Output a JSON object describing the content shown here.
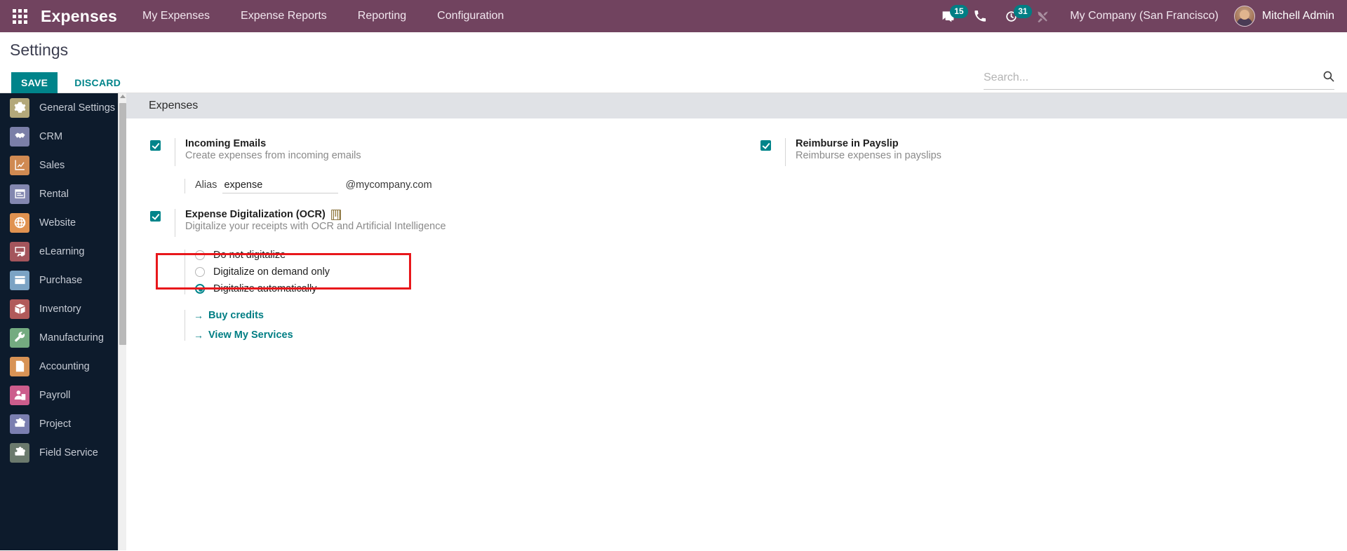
{
  "navbar": {
    "apps_icon": "apps-grid-icon",
    "brand": "Expenses",
    "menus": [
      {
        "label": "My Expenses"
      },
      {
        "label": "Expense Reports"
      },
      {
        "label": "Reporting"
      },
      {
        "label": "Configuration"
      }
    ],
    "messages_icon": "chat-bubble-icon",
    "messages_count": "15",
    "phone_icon": "phone-icon",
    "activities_icon": "clock-icon",
    "activities_count": "31",
    "debug_icon": "wrench-screwdriver-icon",
    "company": "My Company (San Francisco)",
    "user_name": "Mitchell Admin",
    "avatar": "user-avatar"
  },
  "control_panel": {
    "breadcrumb": "Settings",
    "save_label": "SAVE",
    "discard_label": "DISCARD",
    "search_placeholder": "Search...",
    "search_value": "",
    "search_icon": "search-icon"
  },
  "sidebar": {
    "items": [
      {
        "label": "General Settings",
        "icon": "gear-icon",
        "color": "#b3a87a"
      },
      {
        "label": "CRM",
        "icon": "handshake-icon",
        "color": "#7b7fa8"
      },
      {
        "label": "Sales",
        "icon": "chart-line-icon",
        "color": "#d08a52"
      },
      {
        "label": "Rental",
        "icon": "calendar-icon",
        "color": "#8387b0"
      },
      {
        "label": "Website",
        "icon": "globe-icon",
        "color": "#e09250"
      },
      {
        "label": "eLearning",
        "icon": "presentation-icon",
        "color": "#a4555c"
      },
      {
        "label": "Purchase",
        "icon": "credit-card-icon",
        "color": "#7ba3c4"
      },
      {
        "label": "Inventory",
        "icon": "box-icon",
        "color": "#b15a5a"
      },
      {
        "label": "Manufacturing",
        "icon": "wrench-icon",
        "color": "#74ab80"
      },
      {
        "label": "Accounting",
        "icon": "invoice-icon",
        "color": "#d89355"
      },
      {
        "label": "Payroll",
        "icon": "employee-icon",
        "color": "#cc5d8c"
      },
      {
        "label": "Project",
        "icon": "puzzle-icon",
        "color": "#7b7fb0"
      },
      {
        "label": "Field Service",
        "icon": "puzzle-icon",
        "color": "#6b7a6d"
      }
    ]
  },
  "settings": {
    "block_title": "Expenses",
    "left_column": {
      "incoming_emails": {
        "label": "Incoming Emails",
        "help": "Create expenses from incoming emails",
        "checked": true
      },
      "alias": {
        "label": "Alias",
        "value": "expense",
        "placeholder": "",
        "domain": "@mycompany.com"
      },
      "ocr": {
        "label": "Expense Digitalization (OCR)",
        "help": "Digitalize your receipts with OCR and Artificial Intelligence",
        "checked": true,
        "enterprise_badge": "enterprise-badge-icon",
        "options": [
          {
            "label": "Do not digitalize",
            "selected": false
          },
          {
            "label": "Digitalize on demand only",
            "selected": false
          },
          {
            "label": "Digitalize automatically",
            "selected": true
          }
        ],
        "links": [
          {
            "label": "Buy credits",
            "arrow": "→"
          },
          {
            "label": "View My Services",
            "arrow": "→"
          }
        ]
      }
    },
    "right_column": {
      "reimburse": {
        "label": "Reimburse in Payslip",
        "help": "Reimburse expenses in payslips",
        "checked": true
      }
    }
  },
  "colors": {
    "brand_purple": "#71435f",
    "accent_teal": "#00848a",
    "highlight_red": "#e8171b",
    "sidebar_dark": "#0d1b2c"
  }
}
